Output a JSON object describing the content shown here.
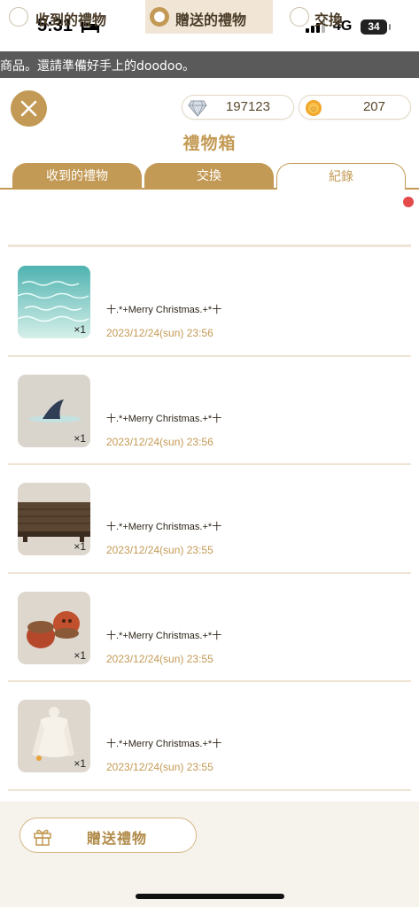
{
  "status_bar": {
    "time": "5:31",
    "network": "4G",
    "battery": "34",
    "icons": [
      "bed-icon",
      "signal-icon"
    ]
  },
  "ticker": {
    "text": "商品。還請準備好手上的doodoo。"
  },
  "header": {
    "close_icon": "close-icon",
    "diamonds": "197123",
    "coins": "207",
    "title": "禮物箱"
  },
  "tabs": [
    {
      "label": "收到的禮物"
    },
    {
      "label": "交換"
    },
    {
      "label": "紀錄"
    }
  ],
  "filters": [
    {
      "label": "收到的禮物",
      "selected": false
    },
    {
      "label": "贈送的禮物",
      "selected": true
    },
    {
      "label": "交換",
      "selected": false
    }
  ],
  "colors": {
    "accent": "#c39a55",
    "notify": "#e44a4a",
    "selected_bg": "#f1e6d5"
  },
  "gifts": [
    {
      "item": "water",
      "qty": "×1",
      "message": "十.*+Merry Christmas.+*十",
      "date": "2023/12/24(sun) 23:56"
    },
    {
      "item": "shark-fin",
      "qty": "×1",
      "message": "十.*+Merry Christmas.+*十",
      "date": "2023/12/24(sun) 23:56"
    },
    {
      "item": "wooden-deck",
      "qty": "×1",
      "message": "十.*+Merry Christmas.+*十",
      "date": "2023/12/24(sun) 23:55"
    },
    {
      "item": "acorns",
      "qty": "×1",
      "message": "十.*+Merry Christmas.+*十",
      "date": "2023/12/24(sun) 23:55"
    },
    {
      "item": "white-sweater",
      "qty": "×1",
      "message": "十.*+Merry Christmas.+*十",
      "date": "2023/12/24(sun) 23:55"
    }
  ],
  "footer": {
    "send_label": "贈送禮物",
    "gift_icon": "gift-icon"
  }
}
